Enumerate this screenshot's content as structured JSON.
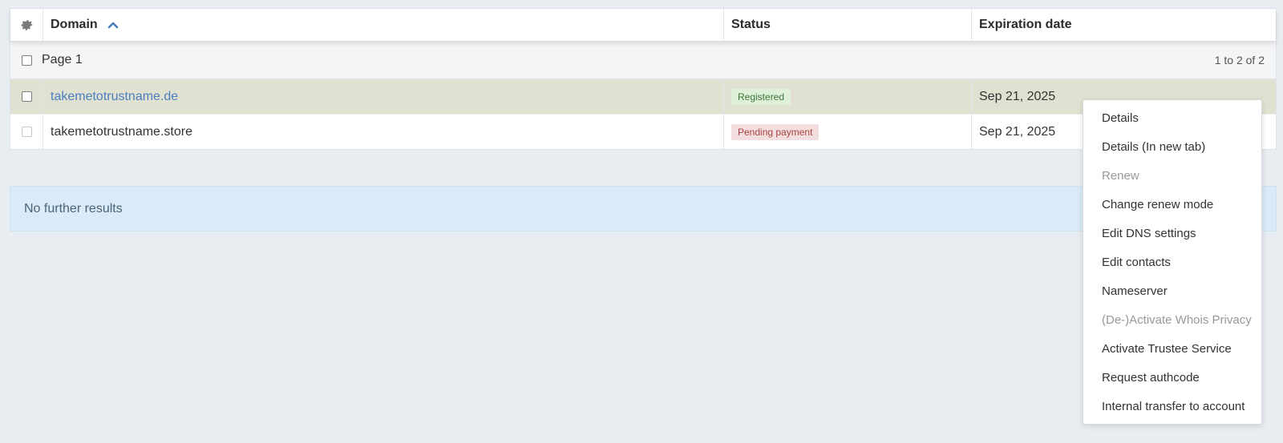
{
  "table": {
    "headers": {
      "domain": "Domain",
      "status": "Status",
      "expiration": "Expiration date"
    },
    "sort": {
      "column": "domain",
      "direction": "ascending"
    },
    "page_label": "Page 1",
    "range_label": "1 to 2 of 2",
    "rows": [
      {
        "domain": "takemetotrustname.de",
        "status": "Registered",
        "expiration": "Sep 21, 2025",
        "selected_highlight": true
      },
      {
        "domain": "takemetotrustname.store",
        "status": "Pending payment",
        "expiration": "Sep 21, 2025",
        "selected_highlight": false
      }
    ]
  },
  "info": {
    "message": "No further results"
  },
  "context_menu": {
    "items": [
      {
        "label": "Details",
        "enabled": true
      },
      {
        "label": "Details (In new tab)",
        "enabled": true
      },
      {
        "label": "Renew",
        "enabled": false
      },
      {
        "label": "Change renew mode",
        "enabled": true
      },
      {
        "label": "Edit DNS settings",
        "enabled": true
      },
      {
        "label": "Edit contacts",
        "enabled": true
      },
      {
        "label": "Nameserver",
        "enabled": true
      },
      {
        "label": "(De-)Activate Whois Privacy",
        "enabled": false
      },
      {
        "label": "Activate Trustee Service",
        "enabled": true
      },
      {
        "label": "Request authcode",
        "enabled": true
      },
      {
        "label": "Internal transfer to account",
        "enabled": true
      }
    ]
  },
  "colors": {
    "link": "#4a7ec0",
    "row_highlight": "#e0e1d1",
    "registered_bg": "#dff0d8",
    "pending_bg": "#f2dede",
    "info_bg": "#daeaf6"
  },
  "icons": [
    "gear-icon",
    "chevron-up-icon"
  ]
}
